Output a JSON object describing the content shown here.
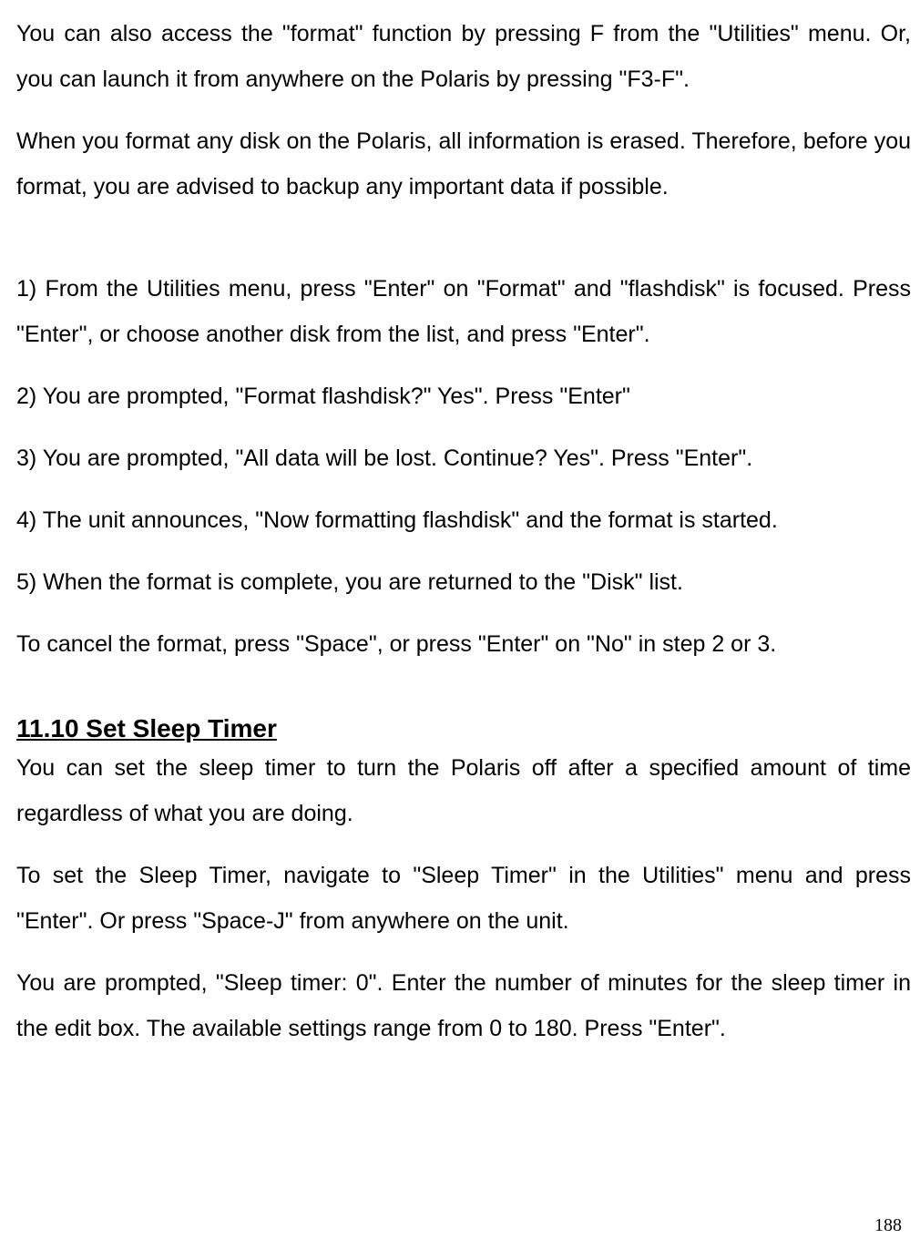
{
  "paragraphs": {
    "p1": "You can also access the \"format\" function by pressing F from the \"Utilities\" menu. Or, you can launch it from anywhere on the Polaris by pressing \"F3-F\".",
    "p2": "When you format any disk on the Polaris, all information is erased. Therefore, before you format, you are advised to backup any important data if possible.",
    "s1": "1) From the Utilities menu, press \"Enter\" on \"Format\" and \"flashdisk\" is focused. Press \"Enter\", or choose another disk from the list, and press \"Enter\".",
    "s2": "2) You are prompted, \"Format flashdisk?\" Yes\". Press \"Enter\"",
    "s3": "3) You are prompted, \"All data will be lost. Continue? Yes\". Press \"Enter\".",
    "s4": "4) The unit announces, \"Now formatting flashdisk\" and the format is started.",
    "s5": "5) When the format is complete, you are returned to the \"Disk\" list.",
    "cancel": "To cancel the format, press \"Space\", or press \"Enter\" on \"No\" in step 2 or 3."
  },
  "section": {
    "heading": "11.10 Set Sleep Timer",
    "p1": "You can set the sleep timer to turn the Polaris off after a specified amount of time regardless of what you are doing.",
    "p2": "To set the Sleep Timer, navigate to \"Sleep Timer\" in the Utilities\" menu and press \"Enter\". Or press \"Space-J\" from anywhere on the unit.",
    "p3": "You are prompted, \"Sleep timer: 0\". Enter the number of minutes for the sleep timer in the edit box. The available settings range from 0 to 180. Press \"Enter\"."
  },
  "page_number": "188"
}
